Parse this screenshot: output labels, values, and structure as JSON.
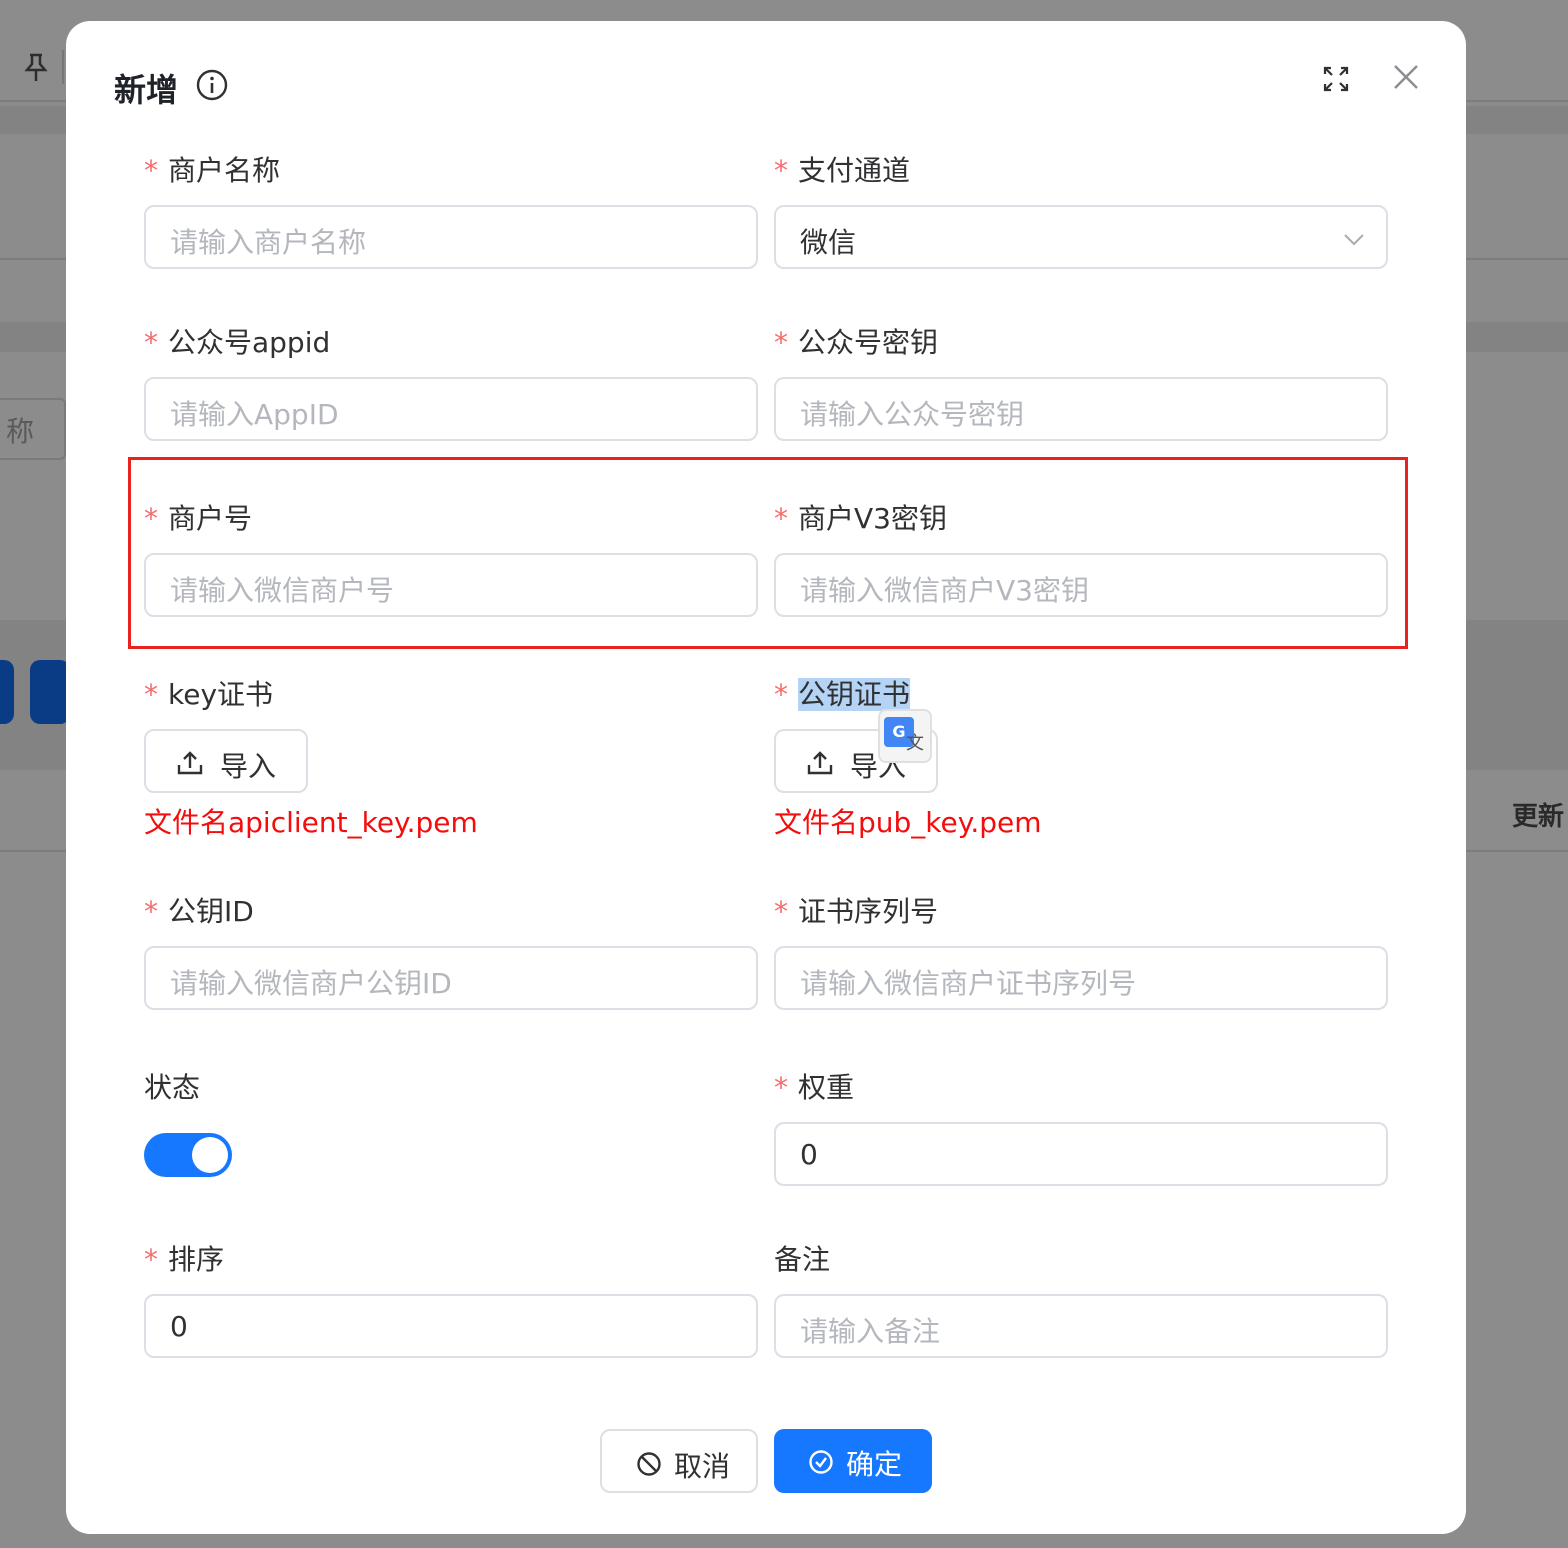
{
  "background": {
    "partial_input_text": "称",
    "partial_column_text": "更新"
  },
  "modal": {
    "title": "新增",
    "icons": {
      "info": "info-icon",
      "fullscreen": "fullscreen-icon",
      "close": "close-icon"
    },
    "fields": {
      "merchant_name": {
        "label": "商户名称",
        "placeholder": "请输入商户名称"
      },
      "pay_channel": {
        "label": "支付通道",
        "value": "微信"
      },
      "appid": {
        "label": "公众号appid",
        "placeholder": "请输入AppID"
      },
      "app_secret": {
        "label": "公众号密钥",
        "placeholder": "请输入公众号密钥"
      },
      "merchant_no": {
        "label": "商户号",
        "placeholder": "请输入微信商户号"
      },
      "v3_key": {
        "label": "商户V3密钥",
        "placeholder": "请输入微信商户V3密钥"
      },
      "key_cert": {
        "label": "key证书",
        "button": "导入",
        "hint": "文件名apiclient_key.pem"
      },
      "pub_cert": {
        "label": "公钥证书",
        "button": "导入",
        "hint": "文件名pub_key.pem"
      },
      "pub_key_id": {
        "label": "公钥ID",
        "placeholder": "请输入微信商户公钥ID"
      },
      "cert_serial": {
        "label": "证书序列号",
        "placeholder": "请输入微信商户证书序列号"
      },
      "status": {
        "label": "状态",
        "enabled": true
      },
      "weight": {
        "label": "权重",
        "value": "0"
      },
      "sort": {
        "label": "排序",
        "value": "0"
      },
      "remark": {
        "label": "备注",
        "placeholder": "请输入备注"
      }
    },
    "required_mark": "*",
    "footer": {
      "cancel": "取消",
      "confirm": "确定"
    },
    "translate_popup": {
      "g": "G",
      "wen": "文"
    }
  },
  "colors": {
    "primary": "#1677ff",
    "required": "#f56c6c",
    "hint": "#f50d0d",
    "highlight_border": "#e8231f"
  }
}
